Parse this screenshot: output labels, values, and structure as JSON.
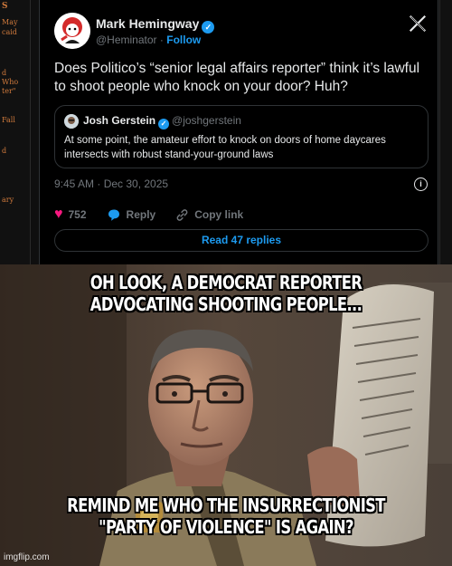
{
  "left_strip": {
    "fragments": [
      "S",
      "May",
      "caid",
      "d",
      "Who",
      "ter\"",
      "Fall",
      "d",
      "ary"
    ]
  },
  "post": {
    "author_name": "Mark Hemingway",
    "handle": "@Heminator",
    "separator": "·",
    "follow_label": "Follow",
    "text": "Does Politico’s “senior legal affairs reporter” think it’s lawful to shoot people who knock on your door? Huh?",
    "quote": {
      "author_name": "Josh Gerstein",
      "handle": "@joshgerstein",
      "text": "At some point, the amateur effort to knock on doors of home daycares intersects with robust stand-your-ground laws"
    },
    "timestamp": "9:45 AM · Dec 30, 2025",
    "likes": "752",
    "reply_label": "Reply",
    "copy_link_label": "Copy link",
    "read_replies_label": "Read 47 replies"
  },
  "meme": {
    "top_caption": "OH LOOK, A DEMOCRAT REPORTER ADVOCATING SHOOTING PEOPLE...",
    "bottom_caption": "REMIND ME WHO THE INSURRECTIONIST \"PARTY OF VIOLENCE\" IS AGAIN?",
    "watermark": "imgflip.com"
  },
  "colors": {
    "accent_blue": "#1d9bf0",
    "like_pink": "#f91880",
    "strip_orange": "#d07a3c"
  },
  "icons": [
    "verified-badge-icon",
    "x-logo-icon",
    "heart-icon",
    "reply-bubble-icon",
    "link-icon",
    "info-icon"
  ]
}
